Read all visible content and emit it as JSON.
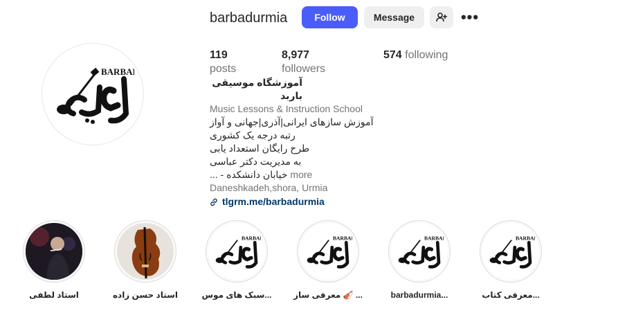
{
  "profile": {
    "username": "barbadurmia",
    "logo_text": "BARBAD",
    "logo_script": "باربد"
  },
  "actions": {
    "follow_label": "Follow",
    "message_label": "Message",
    "add_user_icon": "person-plus-icon",
    "more_icon": "more-icon",
    "more_label": "•••"
  },
  "stats": {
    "posts_count": "119",
    "posts_label": "posts",
    "followers_count": "8,977",
    "followers_label": "followers",
    "following_count": "574",
    "following_label": "following"
  },
  "bio": {
    "name": "آموزشگاه موسیقی باربد",
    "category": "Music Lessons & Instruction School",
    "lines": [
      "آموزش سازهای ایرانی|آذری|جهانی و آواز",
      "رتبه درجه یک کشوری",
      "طرح رایگان استعداد یابی",
      "به مدیریت دکتر عباسی"
    ],
    "last_line": "خیابان دانشکده - ...",
    "more": "more",
    "location": "Daneshkadeh,shora, Urmia",
    "link": "tlgrm.me/barbadurmia",
    "link_icon": "link-icon"
  },
  "highlights": [
    {
      "label": "استاد لطفی",
      "kind": "photo-performer"
    },
    {
      "label": "استاد حسن زاده",
      "kind": "photo-violin"
    },
    {
      "label": "سبک های موس...",
      "kind": "logo"
    },
    {
      "label": "معرفی ساز 🎻 ...",
      "kind": "logo"
    },
    {
      "label": "barbadurmia...",
      "kind": "logo"
    },
    {
      "label": "معرفی کتاب...",
      "kind": "logo"
    }
  ],
  "colors": {
    "follow_button": "#4a5df9",
    "secondary_button": "#efefef",
    "link": "#00376b",
    "muted_text": "#737373"
  }
}
